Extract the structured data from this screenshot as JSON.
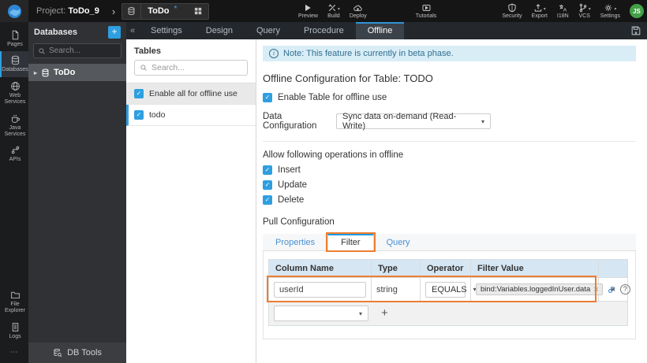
{
  "colors": {
    "accent_blue": "#2e9fe0",
    "annotation_orange": "#ed7d31",
    "note_banner_bg": "#d9edf7",
    "table_header_bg": "#d6e6f3",
    "avatar_green": "#43a047"
  },
  "icons": {
    "check": "✓",
    "collapse": "«",
    "expand": "▸",
    "caret_down": "▾",
    "close": "×",
    "add": "+",
    "more": "⋯",
    "chevron_right": "›",
    "help": "?",
    "info": "i"
  },
  "topbar": {
    "project_label": "Project:",
    "project_name": "ToDo_9",
    "entity": {
      "name": "ToDo",
      "modified_marker": "*"
    },
    "preview": "Preview",
    "build": "Build",
    "deploy": "Deploy",
    "tutorials": "Tutorials",
    "security": "Security",
    "export": "Export",
    "i18n": "I18N",
    "vcs": "VCS",
    "settings": "Settings",
    "avatar_initials": "JS"
  },
  "service_tabs": {
    "tabs": [
      "Settings",
      "Design",
      "Query",
      "Procedure",
      "Offline"
    ],
    "active": "Offline"
  },
  "left_rail": {
    "pages": "Pages",
    "databases": "Databases",
    "web_services": "Web Services",
    "java_services": "Java Services",
    "apis": "APIs",
    "file_explorer": "File Explorer",
    "logs": "Logs",
    "active": "Databases"
  },
  "databases_panel": {
    "title": "Databases",
    "search_placeholder": "Search...",
    "database_name": "ToDo",
    "footer": "DB Tools"
  },
  "tables_panel": {
    "title": "Tables",
    "search_placeholder": "Search...",
    "enable_all": "Enable all for offline use",
    "table_name": "todo"
  },
  "offline_config": {
    "note": "Note: This feature is currently in beta phase.",
    "title": "Offline Configuration for Table: TODO",
    "enable_table": "Enable Table for offline use",
    "data_config_label": "Data Configuration",
    "data_config_value": "Sync data on-demand (Read-Write)",
    "operations_label": "Allow following operations in offline",
    "op_insert": "Insert",
    "op_update": "Update",
    "op_delete": "Delete",
    "pull_config_label": "Pull Configuration",
    "tabs": {
      "properties": "Properties",
      "filter": "Filter",
      "query": "Query",
      "active": "Filter"
    },
    "filter_table": {
      "headers": [
        "Column Name",
        "Type",
        "Operator",
        "Filter Value"
      ],
      "row": {
        "column_name": "userId",
        "type": "string",
        "operator": "EQUALS",
        "filter_value": "bind:Variables.loggedInUser.data"
      }
    }
  }
}
